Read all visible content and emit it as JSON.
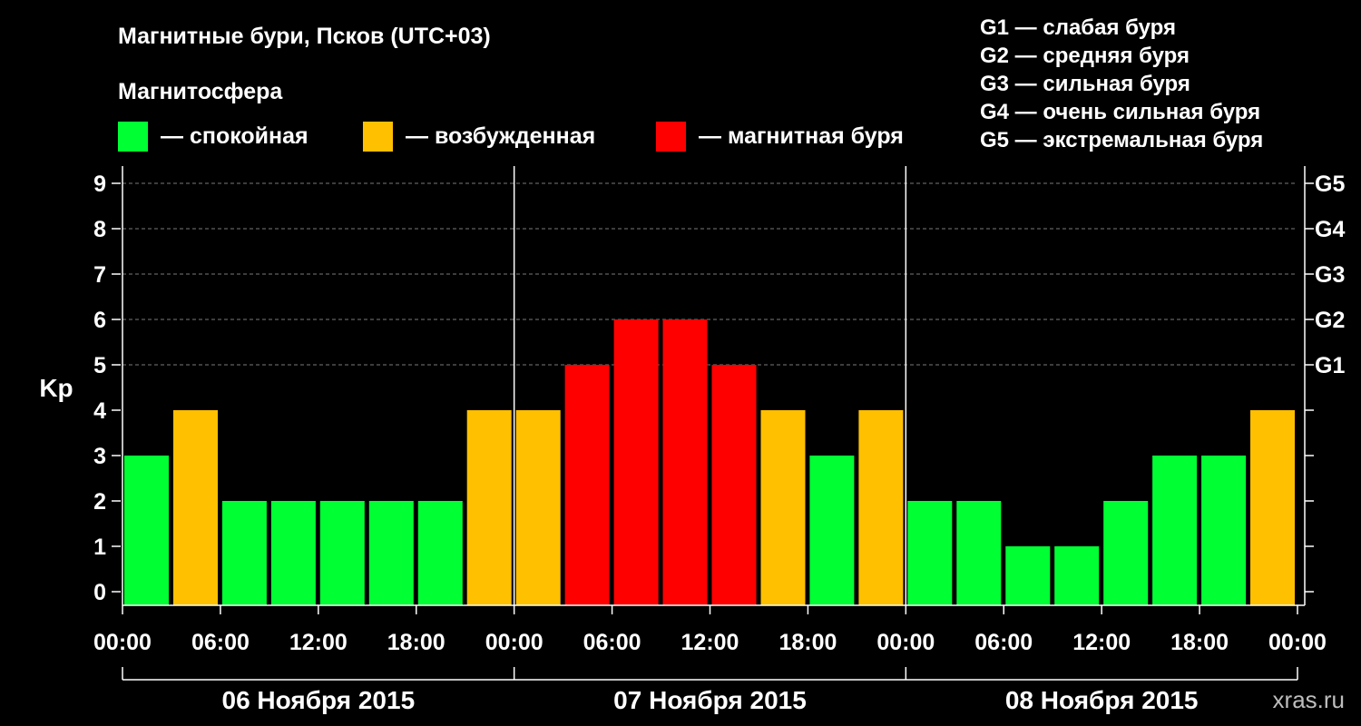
{
  "chart_data": {
    "type": "bar",
    "title": "Магнитные бури, Псков (UTC+03)",
    "subtitle": "Магнитосфера",
    "ylabel": "Kp",
    "ylim": [
      0,
      9
    ],
    "yticks": [
      "0",
      "1",
      "2",
      "3",
      "4",
      "5",
      "6",
      "7",
      "8",
      "9"
    ],
    "storm_levels": [
      {
        "label": "G1",
        "kp": 5
      },
      {
        "label": "G2",
        "kp": 6
      },
      {
        "label": "G3",
        "kp": 7
      },
      {
        "label": "G4",
        "kp": 8
      },
      {
        "label": "G5",
        "kp": 9
      }
    ],
    "legend": [
      {
        "label": "— спокойная",
        "color": "#00ff33"
      },
      {
        "label": "— возбужденная",
        "color": "#ffc000"
      },
      {
        "label": "— магнитная буря",
        "color": "#ff0000"
      }
    ],
    "storm_legend": [
      "G1 — слабая буря",
      "G2 — средняя буря",
      "G3 — сильная буря",
      "G4 — очень сильная буря",
      "G5 — экстремальная буря"
    ],
    "x_tick_labels": [
      "00:00",
      "06:00",
      "12:00",
      "18:00",
      "00:00",
      "06:00",
      "12:00",
      "18:00",
      "00:00",
      "06:00",
      "12:00",
      "18:00",
      "00:00"
    ],
    "days": [
      "06 Ноября 2015",
      "07 Ноября 2015",
      "08 Ноября 2015"
    ],
    "values": [
      3,
      4,
      2,
      2,
      2,
      2,
      2,
      4,
      4,
      5,
      6,
      6,
      5,
      4,
      3,
      4,
      2,
      2,
      1,
      1,
      2,
      3,
      3,
      4
    ],
    "levels": [
      "calm",
      "excited",
      "calm",
      "calm",
      "calm",
      "calm",
      "calm",
      "excited",
      "excited",
      "storm",
      "storm",
      "storm",
      "storm",
      "excited",
      "calm",
      "excited",
      "calm",
      "calm",
      "calm",
      "calm",
      "calm",
      "calm",
      "calm",
      "excited"
    ],
    "colors": {
      "calm": "#00ff33",
      "excited": "#ffc000",
      "storm": "#ff0000"
    },
    "grid": true,
    "watermark": "xras.ru"
  }
}
